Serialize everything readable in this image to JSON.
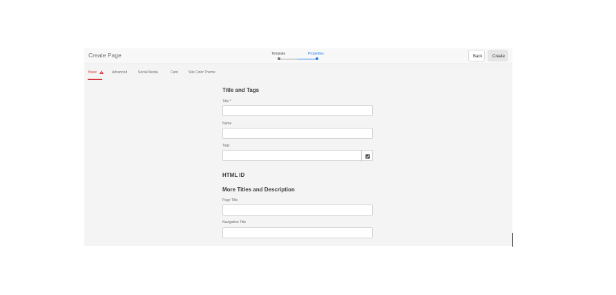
{
  "header": {
    "page_title": "Create Page",
    "wizard": {
      "steps": [
        "Template",
        "Properties"
      ],
      "active_step": 2
    },
    "back_label": "Back",
    "create_label": "Create"
  },
  "tabs": [
    {
      "label": "Basic",
      "active": true,
      "has_alert": true
    },
    {
      "label": "Advanced"
    },
    {
      "label": "Social Media"
    },
    {
      "label": "Card"
    },
    {
      "label": "Site Color Theme"
    }
  ],
  "form": {
    "title_and_tags_heading": "Title and Tags",
    "title_label": "Title *",
    "title_value": "",
    "name_label": "Name",
    "name_value": "",
    "tags_label": "Tags",
    "tags_value": "",
    "html_id_heading": "HTML ID",
    "more_titles_heading": "More Titles and Description",
    "page_title_label": "Page Title",
    "page_title_value": "",
    "navigation_title_label": "Navigation Title",
    "navigation_title_value": ""
  },
  "colors": {
    "accent": "#2680eb",
    "alert": "#d7373f",
    "panel": "#f4f4f4"
  },
  "icons": {
    "alert": "alert-triangle-icon",
    "tags_picker": "checkbox-picker-icon"
  }
}
